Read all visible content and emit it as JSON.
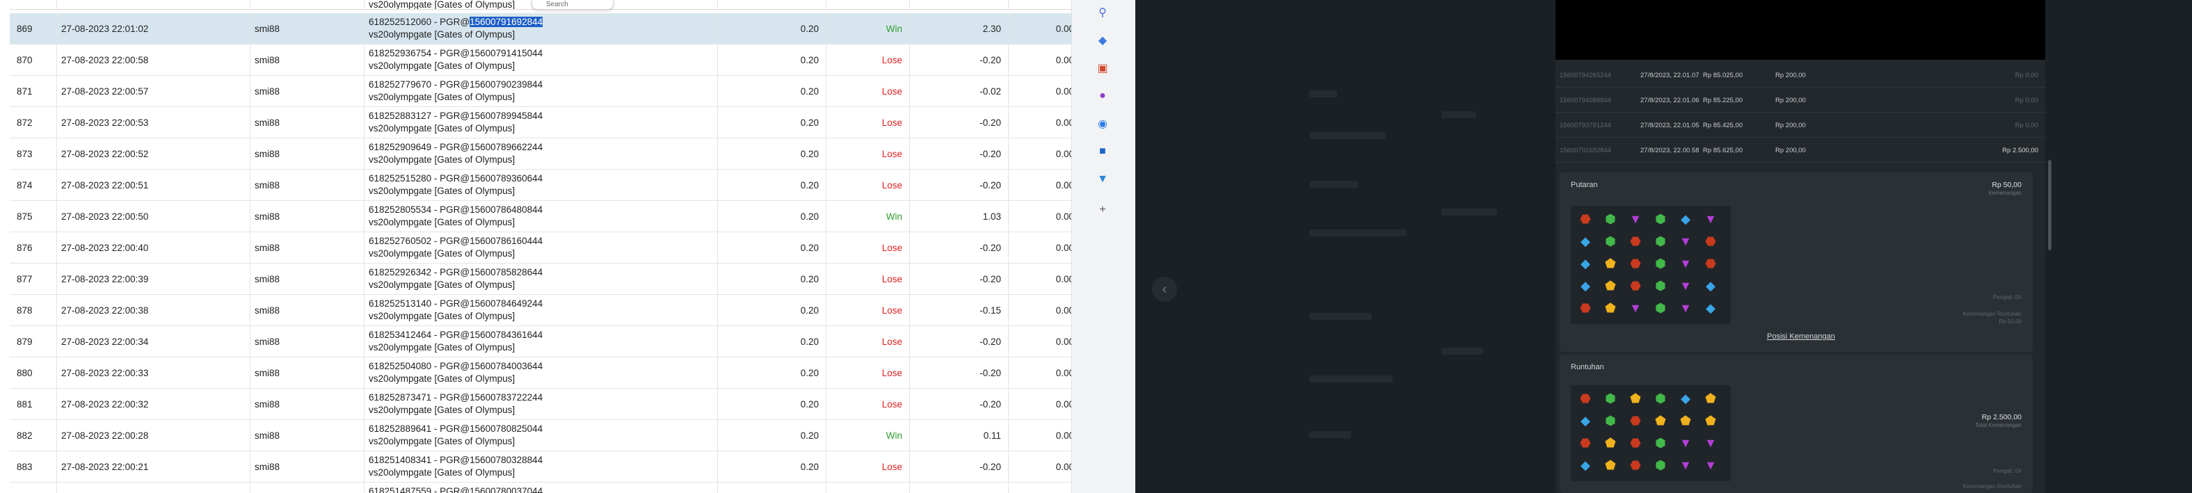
{
  "left_table": {
    "top_partial": {
      "desc2": "vs20olympgate [Gates of Olympus]",
      "search_label": "Search"
    },
    "rows": [
      {
        "no": "869",
        "datetime": "27-08-2023 22:01:02",
        "user": "smi88",
        "desc_id": "618252512060 - PGR@",
        "desc_ref": "15600791692844",
        "desc_game": "vs20olympgate [Gates of Olympus]",
        "bet": "0.20",
        "result": "Win",
        "amount": "2.30",
        "balance": "0.00"
      },
      {
        "no": "870",
        "datetime": "27-08-2023 22:00:58",
        "user": "smi88",
        "desc_id": "618252936754 - PGR@",
        "desc_ref": "15600791415044",
        "desc_game": "vs20olympgate [Gates of Olympus]",
        "bet": "0.20",
        "result": "Lose",
        "amount": "-0.20",
        "balance": "0.00"
      },
      {
        "no": "871",
        "datetime": "27-08-2023 22:00:57",
        "user": "smi88",
        "desc_id": "618252779670 - PGR@",
        "desc_ref": "15600790239844",
        "desc_game": "vs20olympgate [Gates of Olympus]",
        "bet": "0.20",
        "result": "Lose",
        "amount": "-0.02",
        "balance": "0.00"
      },
      {
        "no": "872",
        "datetime": "27-08-2023 22:00:53",
        "user": "smi88",
        "desc_id": "618252883127 - PGR@",
        "desc_ref": "15600789945844",
        "desc_game": "vs20olympgate [Gates of Olympus]",
        "bet": "0.20",
        "result": "Lose",
        "amount": "-0.20",
        "balance": "0.00"
      },
      {
        "no": "873",
        "datetime": "27-08-2023 22:00:52",
        "user": "smi88",
        "desc_id": "618252909649 - PGR@",
        "desc_ref": "15600789662244",
        "desc_game": "vs20olympgate [Gates of Olympus]",
        "bet": "0.20",
        "result": "Lose",
        "amount": "-0.20",
        "balance": "0.00"
      },
      {
        "no": "874",
        "datetime": "27-08-2023 22:00:51",
        "user": "smi88",
        "desc_id": "618252515280 - PGR@",
        "desc_ref": "15600789360644",
        "desc_game": "vs20olympgate [Gates of Olympus]",
        "bet": "0.20",
        "result": "Lose",
        "amount": "-0.20",
        "balance": "0.00"
      },
      {
        "no": "875",
        "datetime": "27-08-2023 22:00:50",
        "user": "smi88",
        "desc_id": "618252805534 - PGR@",
        "desc_ref": "15600786480844",
        "desc_game": "vs20olympgate [Gates of Olympus]",
        "bet": "0.20",
        "result": "Win",
        "amount": "1.03",
        "balance": "0.00"
      },
      {
        "no": "876",
        "datetime": "27-08-2023 22:00:40",
        "user": "smi88",
        "desc_id": "618252760502 - PGR@",
        "desc_ref": "15600786160444",
        "desc_game": "vs20olympgate [Gates of Olympus]",
        "bet": "0.20",
        "result": "Lose",
        "amount": "-0.20",
        "balance": "0.00"
      },
      {
        "no": "877",
        "datetime": "27-08-2023 22:00:39",
        "user": "smi88",
        "desc_id": "618252926342 - PGR@",
        "desc_ref": "15600785828644",
        "desc_game": "vs20olympgate [Gates of Olympus]",
        "bet": "0.20",
        "result": "Lose",
        "amount": "-0.20",
        "balance": "0.00"
      },
      {
        "no": "878",
        "datetime": "27-08-2023 22:00:38",
        "user": "smi88",
        "desc_id": "618252513140 - PGR@",
        "desc_ref": "15600784649244",
        "desc_game": "vs20olympgate [Gates of Olympus]",
        "bet": "0.20",
        "result": "Lose",
        "amount": "-0.15",
        "balance": "0.00"
      },
      {
        "no": "879",
        "datetime": "27-08-2023 22:00:34",
        "user": "smi88",
        "desc_id": "618253412464 - PGR@",
        "desc_ref": "15600784361644",
        "desc_game": "vs20olympgate [Gates of Olympus]",
        "bet": "0.20",
        "result": "Lose",
        "amount": "-0.20",
        "balance": "0.00"
      },
      {
        "no": "880",
        "datetime": "27-08-2023 22:00:33",
        "user": "smi88",
        "desc_id": "618252504080 - PGR@",
        "desc_ref": "15600784003644",
        "desc_game": "vs20olympgate [Gates of Olympus]",
        "bet": "0.20",
        "result": "Lose",
        "amount": "-0.20",
        "balance": "0.00"
      },
      {
        "no": "881",
        "datetime": "27-08-2023 22:00:32",
        "user": "smi88",
        "desc_id": "618252873471 - PGR@",
        "desc_ref": "15600783722244",
        "desc_game": "vs20olympgate [Gates of Olympus]",
        "bet": "0.20",
        "result": "Lose",
        "amount": "-0.20",
        "balance": "0.00"
      },
      {
        "no": "882",
        "datetime": "27-08-2023 22:00:28",
        "user": "smi88",
        "desc_id": "618252889641 - PGR@",
        "desc_ref": "15600780825044",
        "desc_game": "vs20olympgate [Gates of Olympus]",
        "bet": "0.20",
        "result": "Win",
        "amount": "0.11",
        "balance": "0.00"
      },
      {
        "no": "883",
        "datetime": "27-08-2023 22:00:21",
        "user": "smi88",
        "desc_id": "618251408341 - PGR@",
        "desc_ref": "15600780328844",
        "desc_game": "vs20olympgate [Gates of Olympus]",
        "bet": "0.20",
        "result": "Lose",
        "amount": "-0.20",
        "balance": "0.00"
      }
    ],
    "bottom_partial": {
      "desc1": "618251487559 - PGR@15600780037044"
    }
  },
  "icon_sidebar": [
    {
      "name": "search-icon",
      "glyph": "⚲",
      "color": "#4a6fd8"
    },
    {
      "name": "tag-icon",
      "glyph": "◆",
      "color": "#3d7be0"
    },
    {
      "name": "toolbox-icon",
      "glyph": "▣",
      "color": "#d0482b"
    },
    {
      "name": "people-icon",
      "glyph": "●",
      "color": "#8c3fc4"
    },
    {
      "name": "copilot-icon",
      "glyph": "◉",
      "color": "#2f7be8"
    },
    {
      "name": "outlook-icon",
      "glyph": "■",
      "color": "#1f66c9"
    },
    {
      "name": "cart-icon",
      "glyph": "▼",
      "color": "#2b85d6"
    },
    {
      "name": "add-icon",
      "glyph": "+",
      "color": "#555555"
    }
  ],
  "history": {
    "rows": [
      {
        "id": "15600794265244",
        "date": "27/8/2023, 22.01.07",
        "balance": "Rp 85.025,00",
        "bet": "Rp 200,00",
        "win": "Rp 0,00"
      },
      {
        "id": "15600794088844",
        "date": "27/8/2023, 22.01.06",
        "balance": "Rp 85.225,00",
        "bet": "Rp 200,00",
        "win": "Rp 0,00"
      },
      {
        "id": "15600793781244",
        "date": "27/8/2023, 22.01.05",
        "balance": "Rp 85.425,00",
        "bet": "Rp 200,00",
        "win": "Rp 0,00"
      },
      {
        "id": "15600791692844",
        "date": "27/8/2023, 22.00.58",
        "balance": "Rp 85.625,00",
        "bet": "Rp 200,00",
        "win": "Rp 2.500,00"
      }
    ]
  },
  "spin_card": {
    "title": "Putaran",
    "value": "Rp 50,00",
    "value_sub": "Kemenangan",
    "note1": "Pengali: 0X",
    "note2": "Kemenangan Runtuhan",
    "note3": "Rp 50,00",
    "link": "Posisi Kemenangan",
    "grid": [
      [
        "red",
        "green",
        "purple",
        "green",
        "blue",
        "purple"
      ],
      [
        "blue",
        "green",
        "red",
        "green",
        "purple",
        "red"
      ],
      [
        "blue",
        "yellow",
        "red",
        "green",
        "purple",
        "red"
      ],
      [
        "blue",
        "yellow",
        "red",
        "green",
        "purple",
        "blue"
      ],
      [
        "red",
        "yellow",
        "purple",
        "green",
        "purple",
        "blue"
      ]
    ]
  },
  "tumble_card": {
    "title": "Runtuhan",
    "value": "Rp 2.500,00",
    "value_sub": "Total Kemenangan",
    "note1": "Pengali: 0X",
    "note2": "Kemenangan Runtuhan",
    "grid": [
      [
        "red",
        "green",
        "yellow",
        "green",
        "blue",
        "yellow"
      ],
      [
        "blue",
        "green",
        "red",
        "yellow",
        "yellow",
        "yellow"
      ],
      [
        "red",
        "yellow",
        "red",
        "green",
        "purple",
        "purple"
      ],
      [
        "blue",
        "yellow",
        "red",
        "green",
        "purple",
        "purple"
      ]
    ]
  },
  "colors": {
    "accent_select": "#1e5fc6",
    "win": "#2f9e2f",
    "lose": "#e02020",
    "dark_bg": "#1b2024"
  }
}
